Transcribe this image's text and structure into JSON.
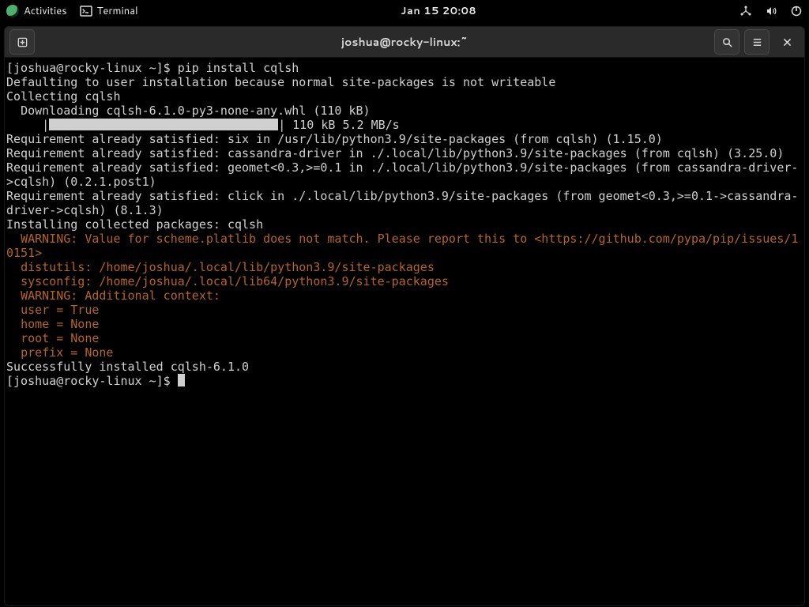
{
  "topbar": {
    "activities": "Activities",
    "app_label": "Terminal",
    "clock": "Jan 15  20:08"
  },
  "window": {
    "title": "joshua@rocky-linux:~"
  },
  "term": {
    "prompt1": "[joshua@rocky-linux ~]$ ",
    "cmd1": "pip install cqlsh",
    "l2": "Defaulting to user installation because normal site-packages is not writeable",
    "l3": "Collecting cqlsh",
    "l4": "  Downloading cqlsh-6.1.0-py3-none-any.whl (110 kB)",
    "l5a": "     |",
    "l5b": "| 110 kB 5.2 MB/s",
    "l6": "Requirement already satisfied: six in /usr/lib/python3.9/site-packages (from cqlsh) (1.15.0)",
    "l7": "Requirement already satisfied: cassandra-driver in ./.local/lib/python3.9/site-packages (from cqlsh) (3.25.0)",
    "l8": "Requirement already satisfied: geomet<0.3,>=0.1 in ./.local/lib/python3.9/site-packages (from cassandra-driver->cqlsh) (0.2.1.post1)",
    "l9": "Requirement already satisfied: click in ./.local/lib/python3.9/site-packages (from geomet<0.3,>=0.1->cassandra-driver->cqlsh) (8.1.3)",
    "l10": "Installing collected packages: cqlsh",
    "w1": "  WARNING: Value for scheme.platlib does not match. Please report this to <https://github.com/pypa/pip/issues/10151>",
    "w2": "  distutils: /home/joshua/.local/lib/python3.9/site-packages",
    "w3": "  sysconfig: /home/joshua/.local/lib64/python3.9/site-packages",
    "w4": "  WARNING: Additional context:",
    "w5": "  user = True",
    "w6": "  home = None",
    "w7": "  root = None",
    "w8": "  prefix = None",
    "l11": "Successfully installed cqlsh-6.1.0",
    "prompt2": "[joshua@rocky-linux ~]$ "
  }
}
